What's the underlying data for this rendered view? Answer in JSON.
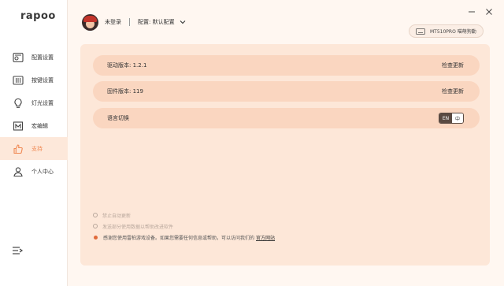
{
  "app": {
    "logo": "rapoo"
  },
  "sidebar": {
    "items": [
      {
        "label": "配置设置",
        "icon": "config-icon",
        "active": false
      },
      {
        "label": "按键设置",
        "icon": "keys-icon",
        "active": false
      },
      {
        "label": "灯光设置",
        "icon": "bulb-icon",
        "active": false
      },
      {
        "label": "宏编辑",
        "icon": "macro-icon",
        "active": false
      },
      {
        "label": "支持",
        "icon": "thumbs-up-icon",
        "active": true
      },
      {
        "label": "个人中心",
        "icon": "user-icon",
        "active": false
      }
    ],
    "menu_icon": "menu-collapse-icon"
  },
  "header": {
    "user_name": "未登录",
    "config_label": "配置: 默认配置",
    "device_name": "MT510PRO 喵萌狗勤"
  },
  "support": {
    "driver_version_label": "驱动版本: 1.2.1",
    "driver_check_update": "检查更新",
    "firmware_version_label": "固件版本: 119",
    "firmware_check_update": "检查更新",
    "language_label": "语言切换",
    "language_en": "EN",
    "language_zh": "中",
    "option_disable_auto_update": "禁止自动更新",
    "option_send_usage_data": "发送部分使用数据以帮助改进软件",
    "thanks_note": "感谢您使用雷柏游戏设备。如果您需要任何信息或帮助，可以访问我们的",
    "official_site_link": "官方网站"
  },
  "colors": {
    "accent": "#f08a55",
    "panel_bg": "#fde7d8",
    "row_bg": "#fad6c0",
    "sidebar_active_bg": "#fde8da"
  }
}
